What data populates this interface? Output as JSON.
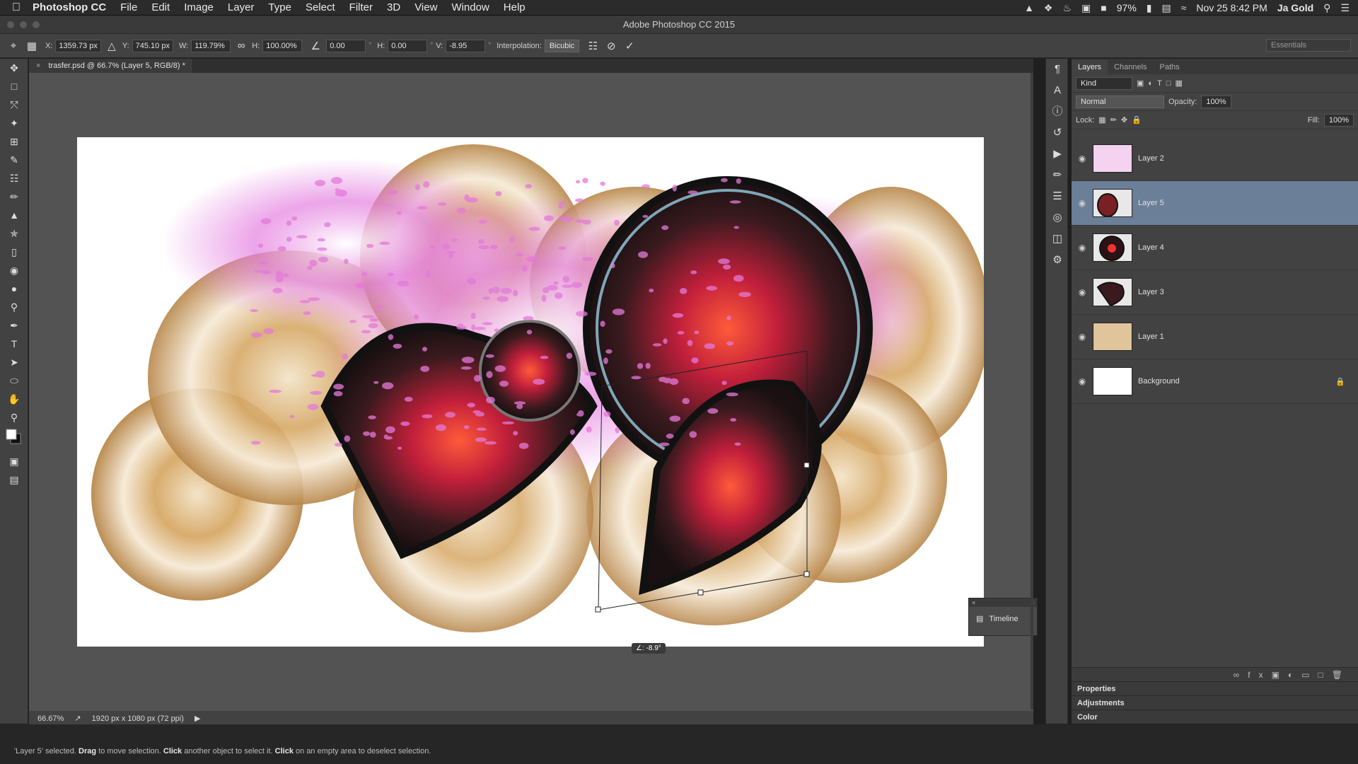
{
  "menubar": {
    "apple": "",
    "app": "Photoshop CC",
    "items": [
      "File",
      "Edit",
      "Image",
      "Layer",
      "Type",
      "Select",
      "Filter",
      "3D",
      "View",
      "Window",
      "Help"
    ],
    "battery": "97%",
    "datetime": "Nov 25  8:42 PM",
    "user": "Ja Gold"
  },
  "window": {
    "title": "Adobe Photoshop CC 2015"
  },
  "options": {
    "x_label": "X:",
    "x_value": "1359.73 px",
    "y_label": "Y:",
    "y_value": "745.10 px",
    "w_label": "W:",
    "w_value": "119.79%",
    "h_label": "H:",
    "h_value": "100.00%",
    "angle_value": "0.00",
    "hskew_label": "H:",
    "hskew_value": "0.00",
    "vskew_label": "V:",
    "vskew_value": "-8.95",
    "interp_label": "Interpolation:",
    "interp_value": "Bicubic",
    "workspace": "Essentials"
  },
  "doc": {
    "tab": "trasfer.psd @ 66.7% (Layer 5, RGB/8) *",
    "zoom": "66.67%",
    "info": "1920 px x 1080 px (72 ppi)",
    "angle_readout": "∠: -8.9°"
  },
  "timeline": {
    "label": "Timeline"
  },
  "layers_panel": {
    "tabs": [
      "Layers",
      "Channels",
      "Paths"
    ],
    "filter": "Kind",
    "blend": "Normal",
    "opacity_label": "Opacity:",
    "opacity": "100%",
    "lock_label": "Lock:",
    "fill_label": "Fill:",
    "fill": "100%",
    "layers": [
      {
        "name": "Layer 2",
        "selected": false
      },
      {
        "name": "Layer 5",
        "selected": true
      },
      {
        "name": "Layer 4",
        "selected": false
      },
      {
        "name": "Layer 3",
        "selected": false
      },
      {
        "name": "Layer 1",
        "selected": false
      },
      {
        "name": "Background",
        "selected": false
      }
    ]
  },
  "collapsed_panels": [
    "Properties",
    "Adjustments",
    "Color"
  ],
  "hint": {
    "p1": "'Layer 5' selected. ",
    "b1": "Drag",
    "p2": " to move selection. ",
    "b2": "Click",
    "p3": " another object to select it. ",
    "b3": "Click",
    "p4": " on an empty area to deselect selection."
  },
  "colors": {
    "selection": "#6b7f99",
    "panel_bg": "#424242",
    "canvas_bg": "#535353"
  }
}
